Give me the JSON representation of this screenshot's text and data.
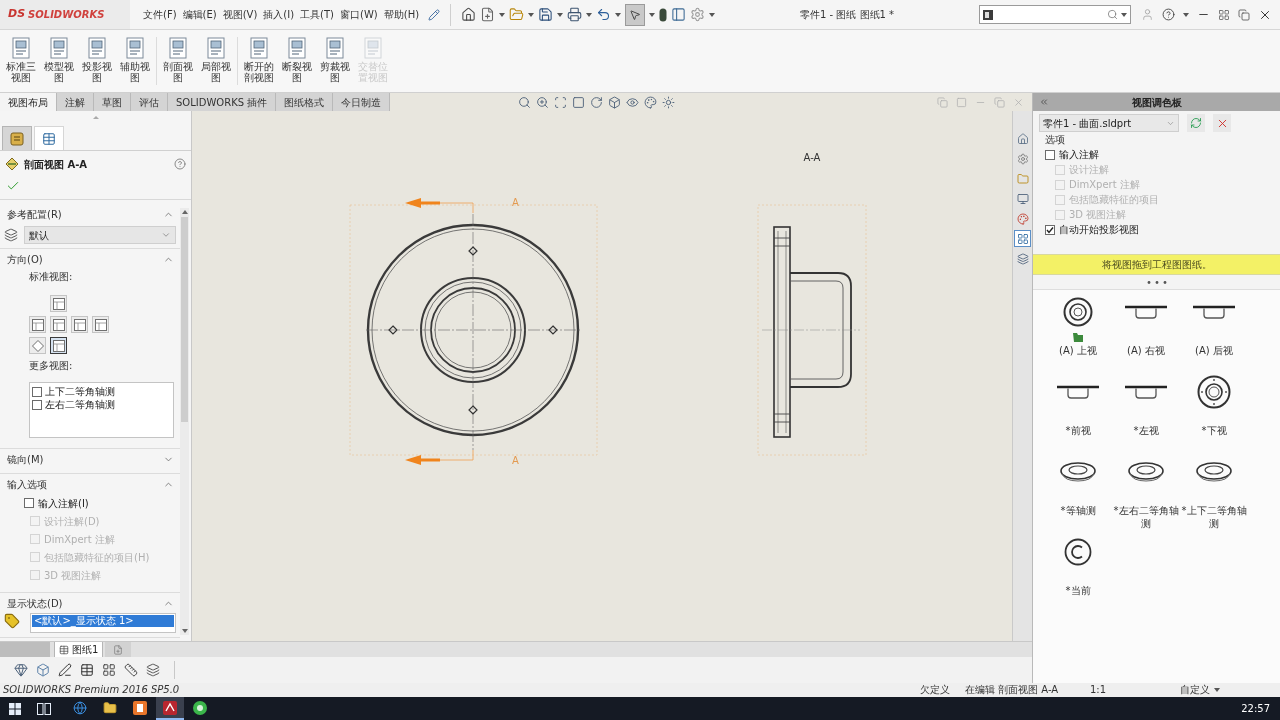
{
  "title_bar": {
    "logo_mark": "DS",
    "logo_text": "SOLIDWORKS",
    "menu": [
      "文件(F)",
      "编辑(E)",
      "视图(V)",
      "插入(I)",
      "工具(T)",
      "窗口(W)",
      "帮助(H)"
    ],
    "select_tool_active": true,
    "document_title": "零件1 - 图纸 图纸1 *"
  },
  "ribbon": {
    "button_groups": [
      [
        {
          "label": "标准三视图",
          "disabled": false
        },
        {
          "label": "模型视图",
          "disabled": false
        },
        {
          "label": "投影视图",
          "disabled": false
        },
        {
          "label": "辅助视图",
          "disabled": false
        }
      ],
      [
        {
          "label": "剖面视图",
          "disabled": false
        },
        {
          "label": "局部视图",
          "disabled": false
        }
      ],
      [
        {
          "label": "断开的剖视图",
          "disabled": false
        },
        {
          "label": "断裂视图",
          "disabled": false
        },
        {
          "label": "剪裁视图",
          "disabled": false
        },
        {
          "label": "交替位置视图",
          "disabled": true
        }
      ]
    ],
    "tabs": [
      {
        "label": "视图布局",
        "selected": true
      },
      {
        "label": "注解",
        "selected": false
      },
      {
        "label": "草图",
        "selected": false
      },
      {
        "label": "评估",
        "selected": false
      },
      {
        "label": "SOLIDWORKS 插件",
        "selected": false
      },
      {
        "label": "图纸格式",
        "selected": false
      },
      {
        "label": "今日制造",
        "selected": false
      }
    ]
  },
  "property_manager": {
    "panel_tabs": [
      {
        "selected": true
      },
      {
        "selected": false
      }
    ],
    "title": "剖面视图 A-A",
    "sections": [
      {
        "kind": "dropdown",
        "title": "参考配置(R)",
        "expanded": true,
        "value": "默认"
      },
      {
        "kind": "orientation",
        "title": "方向(O)",
        "expanded": true,
        "standard_views_label": "标准视图:",
        "standard_views": [
          {
            "kind": "face",
            "selected": false
          },
          {
            "kind": "face",
            "selected": false
          },
          {
            "kind": "face",
            "selected": false
          },
          {
            "kind": "face",
            "selected": false
          },
          {
            "kind": "face",
            "selected": false
          },
          {
            "kind": "iso",
            "selected": false
          },
          {
            "kind": "face",
            "selected": true
          }
        ],
        "more_views_label": "更多视图:",
        "more_views": [
          {
            "label": "上下二等角轴测",
            "checked": false
          },
          {
            "label": "左右二等角轴测",
            "checked": false
          }
        ]
      },
      {
        "title": "镜向(M)",
        "expanded": false
      },
      {
        "kind": "options",
        "title": "输入选项",
        "expanded": true,
        "options": [
          {
            "label": "输入注解(I)",
            "checked": false,
            "disabled": false,
            "children": [
              {
                "label": "设计注解(D)",
                "checked": false,
                "disabled": true
              },
              {
                "label": "DimXpert 注解",
                "checked": false,
                "disabled": true
              },
              {
                "label": "包括隐藏特征的项目(H)",
                "checked": false,
                "disabled": true
              },
              {
                "label": "3D 视图注解",
                "checked": false,
                "disabled": true
              }
            ]
          }
        ]
      },
      {
        "kind": "list",
        "title": "显示状态(D)",
        "expanded": true,
        "items": [
          {
            "label": "<默认>_显示状态 1>",
            "selected": true
          }
        ]
      }
    ]
  },
  "canvas": {
    "section_marks": [
      {
        "label": "A"
      },
      {
        "label": "A"
      }
    ],
    "section_view_title": "A-A"
  },
  "task_pane_tabs": [
    {
      "selected": false
    },
    {
      "selected": false
    },
    {
      "selected": false
    },
    {
      "selected": false
    },
    {
      "selected": false
    },
    {
      "selected": true
    },
    {
      "selected": false
    }
  ],
  "view_palette": {
    "title": "视图调色板",
    "document": "零件1 - 曲面.sldprt",
    "options_label": "选项",
    "options": [
      {
        "label": "输入注解",
        "checked": false,
        "disabled": false,
        "children": [
          {
            "label": "设计注解",
            "checked": false,
            "disabled": true
          },
          {
            "label": "DimXpert 注解",
            "checked": false,
            "disabled": true
          },
          {
            "label": "包括隐藏特征的项目",
            "checked": false,
            "disabled": true
          },
          {
            "label": "3D 视图注解",
            "checked": false,
            "disabled": true
          }
        ]
      },
      {
        "label": "自动开始投影视图",
        "checked": true,
        "disabled": false
      }
    ],
    "hint": "将视图拖到工程图图纸。",
    "views": [
      {
        "kind": "top",
        "label": "(A) 上视",
        "marked": true
      },
      {
        "kind": "side",
        "label": "(A) 右视",
        "marked": false
      },
      {
        "kind": "side",
        "label": "(A) 后视",
        "marked": false
      },
      {
        "kind": "side",
        "label": "*前视",
        "marked": false
      },
      {
        "kind": "side",
        "label": "*左视",
        "marked": false
      },
      {
        "kind": "bottom",
        "label": "*下视",
        "marked": false
      },
      {
        "kind": "iso",
        "label": "*等轴测",
        "marked": false
      },
      {
        "kind": "iso",
        "label": "*左右二等角轴测",
        "marked": false
      },
      {
        "kind": "iso",
        "label": "*上下二等角轴测",
        "marked": false
      },
      {
        "kind": "current",
        "label": "*当前",
        "marked": false
      }
    ]
  },
  "sheet_tabs": [
    {
      "label": "图纸1",
      "selected": true
    }
  ],
  "status_bar": {
    "product": "SOLIDWORKS Premium 2016 SP5.0",
    "fields": [
      "欠定义",
      "在编辑 剖面视图 A-A",
      "1:1"
    ],
    "units": "自定义"
  },
  "taskbar": {
    "apps": [
      {
        "kind": "browser",
        "selected": false
      },
      {
        "kind": "folder",
        "selected": false
      },
      {
        "kind": "office",
        "selected": false
      },
      {
        "kind": "cad",
        "selected": true
      },
      {
        "kind": "chat",
        "selected": false
      }
    ],
    "time": "22:57"
  }
}
